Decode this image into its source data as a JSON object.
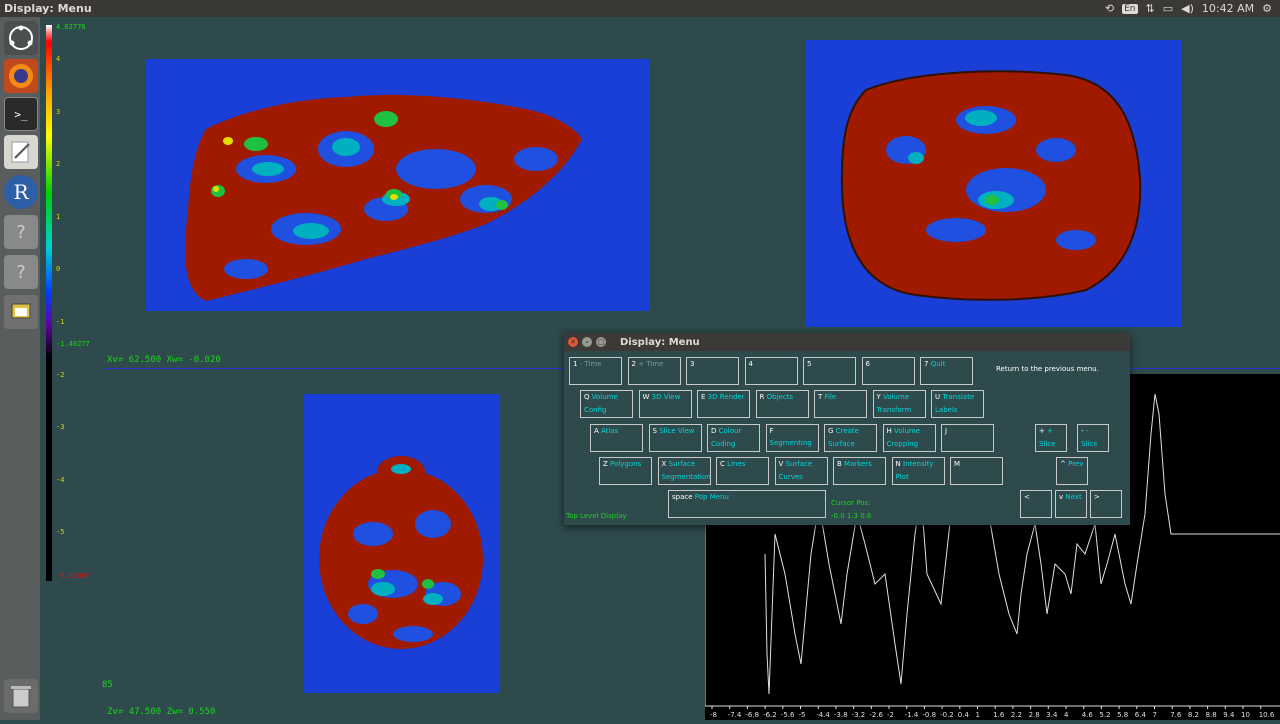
{
  "topbar": {
    "window_title": "Display: Menu",
    "lang": "En",
    "time": "10:42 AM"
  },
  "launcher": {
    "items": [
      "ubuntu-icon",
      "firefox-icon",
      "terminal-icon",
      "text-editor-icon",
      "r-icon",
      "unknown-app-icon",
      "unknown-app-icon",
      "files-icon",
      "trash-icon"
    ]
  },
  "colorbar": {
    "max": "4.62776",
    "ticks": [
      "4",
      "3",
      "2",
      "1",
      "0",
      "-1",
      "-2",
      "-3",
      "-4",
      "-5"
    ],
    "threshold": "-1.40277",
    "min": "-5.62987"
  },
  "panels": {
    "top_left_coords": "Xv=  62.500 Xw=  -0.020",
    "bottom_left_coords": "Zv=  47.500 Zw=   0.550",
    "bottom_left_index": "85"
  },
  "plot": {
    "x_ticks": [
      "-8",
      "-7.4",
      "-6.8",
      "-6.2",
      "-5.6",
      "-5",
      "-4.4",
      "-3.8",
      "-3.2",
      "-2.6",
      "-2",
      "-1.4",
      "-0.8",
      "-0.2",
      "0.4",
      "1",
      "1.6",
      "2.2",
      "2.8",
      "3.4",
      "4",
      "4.6",
      "5.2",
      "5.8",
      "6.4",
      "7",
      "7.6",
      "8.2",
      "8.8",
      "9.4",
      "10",
      "10.6"
    ]
  },
  "menu": {
    "title": "Display: Menu",
    "help": "Return to the previous menu.",
    "top_level": "Top Level Display",
    "cursor_label": "Cursor Pos:",
    "cursor_value": "-0.0 1.3 0.6",
    "row1": [
      {
        "key": "1",
        "label": "- Time",
        "dim": true
      },
      {
        "key": "2",
        "label": "+ Time",
        "dim": true
      },
      {
        "key": "3",
        "label": ""
      },
      {
        "key": "4",
        "label": ""
      },
      {
        "key": "5",
        "label": ""
      },
      {
        "key": "6",
        "label": ""
      },
      {
        "key": "7",
        "label": "Quit"
      }
    ],
    "row2": [
      {
        "key": "Q",
        "label": "Volume",
        "l2": "Config"
      },
      {
        "key": "W",
        "label": "3D View"
      },
      {
        "key": "E",
        "label": "3D Render"
      },
      {
        "key": "R",
        "label": "Objects"
      },
      {
        "key": "T",
        "label": "File"
      },
      {
        "key": "Y",
        "label": "Volume",
        "l2": "Transform"
      },
      {
        "key": "U",
        "label": "Translate",
        "l2": "Labels"
      }
    ],
    "row3": [
      {
        "key": "A",
        "label": "Atlas"
      },
      {
        "key": "S",
        "label": "Slice View"
      },
      {
        "key": "D",
        "label": "Colour",
        "l2": "Coding"
      },
      {
        "key": "F",
        "label": "Segmenting"
      },
      {
        "key": "G",
        "label": "Create",
        "l2": "Surface"
      },
      {
        "key": "H",
        "label": "Volume",
        "l2": "Cropping"
      },
      {
        "key": "J",
        "label": ""
      }
    ],
    "row3_right": [
      {
        "key": "+",
        "label": "+",
        "l2": "Slice"
      },
      {
        "key": "-",
        "label": "-",
        "l2": "Slice"
      }
    ],
    "row4": [
      {
        "key": "Z",
        "label": "Polygons"
      },
      {
        "key": "X",
        "label": "Surface",
        "l2": "Segmentation"
      },
      {
        "key": "C",
        "label": "Lines"
      },
      {
        "key": "V",
        "label": "Surface",
        "l2": "Curves"
      },
      {
        "key": "B",
        "label": "Markers"
      },
      {
        "key": "N",
        "label": "Intensity",
        "l2": "Plot"
      },
      {
        "key": "M",
        "label": ""
      }
    ],
    "prev": {
      "key": "^",
      "label": "Prev"
    },
    "space": {
      "key": "space",
      "label": "Pop Menu"
    },
    "nav": [
      {
        "key": "<",
        "label": ""
      },
      {
        "key": "v",
        "label": "Next"
      },
      {
        "key": ">",
        "label": ""
      }
    ]
  }
}
